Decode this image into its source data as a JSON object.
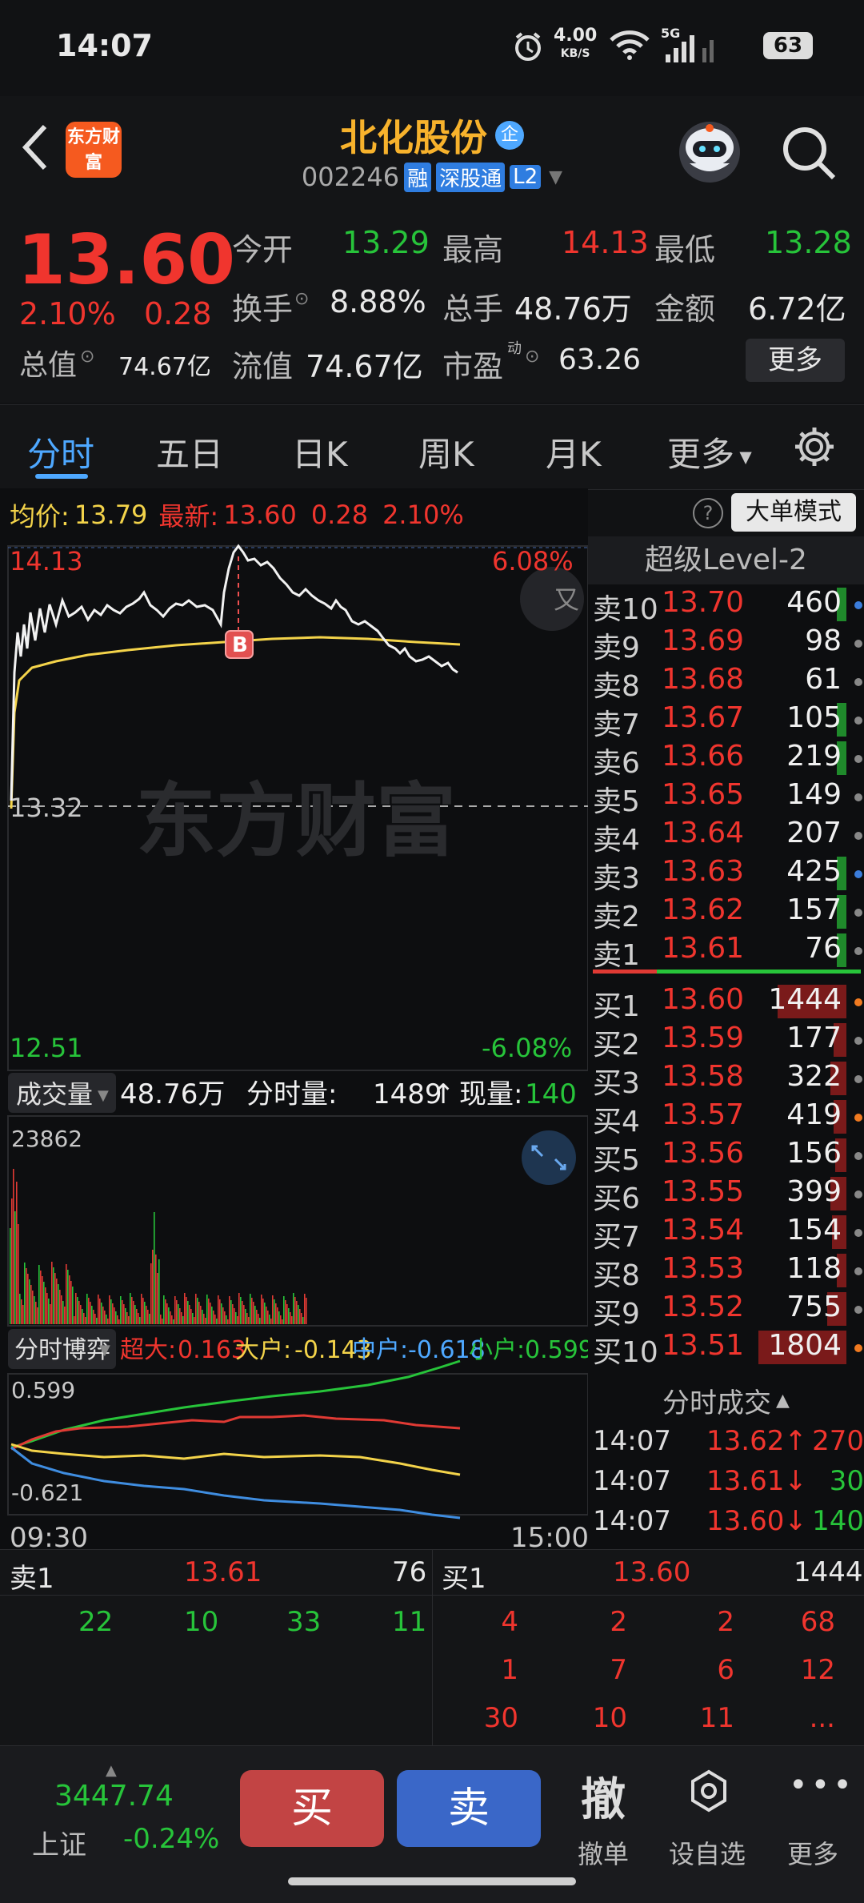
{
  "status": {
    "time": "14:07",
    "net_speed": "4.00",
    "net_unit": "KB/S",
    "signal": "5G",
    "battery": "63"
  },
  "header": {
    "logo": "东方财富",
    "stock_name": "北化股份",
    "badge_qi": "企",
    "code": "002246",
    "tag_rong": "融",
    "tag_sgt": "深股通",
    "tag_l2": "L2"
  },
  "quote": {
    "price": "13.60",
    "change_pct": "2.10%",
    "change": "0.28",
    "open_label": "今开",
    "open": "13.29",
    "high_label": "最高",
    "high": "14.13",
    "low_label": "最低",
    "low": "13.28",
    "turnover_label": "换手",
    "turnover": "8.88%",
    "vol_label": "总手",
    "vol": "48.76万",
    "amount_label": "金额",
    "amount": "6.72亿",
    "mcap_label": "总值",
    "mcap": "74.67亿",
    "float_label": "流值",
    "float": "74.67亿",
    "pe_label": "市盈",
    "pe_sup": "动",
    "pe": "63.26",
    "more_btn": "更多"
  },
  "tabs": [
    "分时",
    "五日",
    "日K",
    "周K",
    "月K",
    "更多"
  ],
  "chart_info": {
    "avg_label": "均价:",
    "avg": "13.79",
    "latest_label": "最新:",
    "latest": "13.60",
    "chg": "0.28",
    "pct": "2.10%",
    "help": "?",
    "mode_btn": "大单模式"
  },
  "price_chart": {
    "max": "14.13",
    "max_pct": "6.08%",
    "mid": "13.32",
    "min": "12.51",
    "min_pct": "-6.08%",
    "watermark": "东方财富",
    "marker": "B",
    "toggle": "又"
  },
  "volume": {
    "label": "成交量",
    "total": "48.76万",
    "tick_label": "分时量:",
    "tick": "1489",
    "now_label": "现量:",
    "now": "140",
    "ymax": "23862"
  },
  "game": {
    "label": "分时博弈",
    "super_label": "超大:",
    "super": "0.163",
    "big_label": "大户:",
    "big": "-0.143",
    "mid_label": "中户:",
    "mid": "-0.618",
    "small_label": "小户:",
    "small": "0.599",
    "ymax": "0.599",
    "ymin": "-0.621",
    "t_start": "09:30",
    "t_end": "15:00"
  },
  "orderbook": {
    "title": "超级Level-2",
    "asks": [
      {
        "label": "卖10",
        "price": "13.70",
        "vol": "460"
      },
      {
        "label": "卖9",
        "price": "13.69",
        "vol": "98"
      },
      {
        "label": "卖8",
        "price": "13.68",
        "vol": "61"
      },
      {
        "label": "卖7",
        "price": "13.67",
        "vol": "105"
      },
      {
        "label": "卖6",
        "price": "13.66",
        "vol": "219"
      },
      {
        "label": "卖5",
        "price": "13.65",
        "vol": "149"
      },
      {
        "label": "卖4",
        "price": "13.64",
        "vol": "207"
      },
      {
        "label": "卖3",
        "price": "13.63",
        "vol": "425"
      },
      {
        "label": "卖2",
        "price": "13.62",
        "vol": "157"
      },
      {
        "label": "卖1",
        "price": "13.61",
        "vol": "76"
      }
    ],
    "bids": [
      {
        "label": "买1",
        "price": "13.60",
        "vol": "1444"
      },
      {
        "label": "买2",
        "price": "13.59",
        "vol": "177"
      },
      {
        "label": "买3",
        "price": "13.58",
        "vol": "322"
      },
      {
        "label": "买4",
        "price": "13.57",
        "vol": "419"
      },
      {
        "label": "买5",
        "price": "13.56",
        "vol": "156"
      },
      {
        "label": "买6",
        "price": "13.55",
        "vol": "399"
      },
      {
        "label": "买7",
        "price": "13.54",
        "vol": "154"
      },
      {
        "label": "买8",
        "price": "13.53",
        "vol": "118"
      },
      {
        "label": "买9",
        "price": "13.52",
        "vol": "755"
      },
      {
        "label": "买10",
        "price": "13.51",
        "vol": "1804"
      }
    ],
    "trades_title": "分时成交",
    "trades": [
      {
        "time": "14:07",
        "price": "13.62↑",
        "vol": "270"
      },
      {
        "time": "14:07",
        "price": "13.61↓",
        "vol": "30"
      },
      {
        "time": "14:07",
        "price": "13.60↓",
        "vol": "140"
      }
    ]
  },
  "detail": {
    "sell1": {
      "label": "卖1",
      "price": "13.61",
      "vol": "76"
    },
    "buy1": {
      "label": "买1",
      "price": "13.60",
      "vol": "1444"
    },
    "sell_queue": [
      "22",
      "10",
      "33",
      "11"
    ],
    "buy_queue": [
      [
        "4",
        "2",
        "2",
        "68"
      ],
      [
        "1",
        "7",
        "6",
        "12"
      ],
      [
        "30",
        "10",
        "11",
        "..."
      ]
    ]
  },
  "bottombar": {
    "index_value": "3447.74",
    "index_name": "上证",
    "index_pct": "-0.24%",
    "buy": "买",
    "sell": "卖",
    "cancel_icon": "撤",
    "cancel": "撤单",
    "watch": "设自选",
    "more": "更多"
  },
  "colors": {
    "up": "#f0352e",
    "down": "#27c43a",
    "avg_line": "#f3d34a",
    "accent": "#4ea8ff",
    "brand": "#f55a1f"
  }
}
